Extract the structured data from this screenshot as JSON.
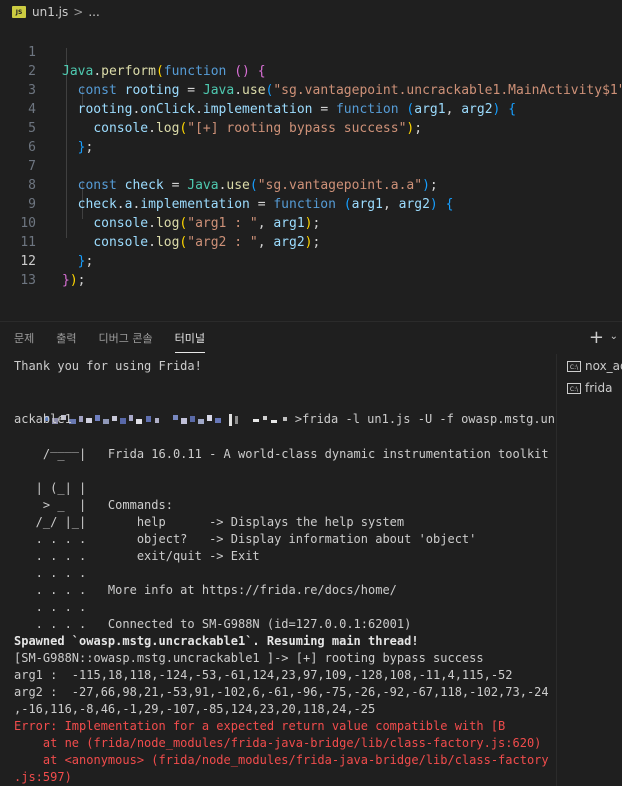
{
  "breadcrumb": {
    "file_icon": "JS",
    "filename": "un1.js",
    "separator": ">",
    "more": "..."
  },
  "editor": {
    "line_numbers": [
      "1",
      "2",
      "3",
      "4",
      "5",
      "6",
      "7",
      "8",
      "9",
      "10",
      "11",
      "12",
      "13"
    ]
  },
  "panel": {
    "tabs": [
      "문제",
      "출력",
      "디버그 콘솔",
      "터미널"
    ],
    "active_tab": 3,
    "new_terminal": "+",
    "dropdown": "⌄"
  },
  "terminal": {
    "thank_you": "Thank you for using Frida!",
    "cmd": ">frida -l un1.js -U -f owasp.mstg.uncr",
    "cmd_cont": "ackable1",
    "logo1": "     ____",
    "logo2": "    / _  |   Frida 16.0.11 - A world-class dynamic instrumentation toolkit",
    "logo3": "   | (_| |",
    "logo4": "    > _  |   Commands:",
    "logo5": "   /_/ |_|       help      -> Displays the help system",
    "logo6": "   . . . .       object?   -> Display information about 'object'",
    "logo7": "   . . . .       exit/quit -> Exit",
    "logo8": "   . . . .",
    "logo9": "   . . . .   More info at https://frida.re/docs/home/",
    "logo10": "   . . . .",
    "logo11": "   . . . .   Connected to SM-G988N (id=127.0.0.1:62001)",
    "spawned": "Spawned `owasp.mstg.uncrackable1`. Resuming main thread!",
    "prompt": "[SM-G988N::owasp.mstg.uncrackable1 ]-> [+] rooting bypass success",
    "arg1": "arg1 :  -115,18,118,-124,-53,-61,124,23,97,109,-128,108,-11,4,115,-52",
    "arg2a": "arg2 :  -27,66,98,21,-53,91,-102,6,-61,-96,-75,-26,-92,-67,118,-102,73,-24",
    "arg2b": ",-16,116,-8,46,-1,29,-107,-85,124,23,20,118,24,-25",
    "err1": "Error: Implementation for a expected return value compatible with [B",
    "err2": "    at ne (frida/node_modules/frida-java-bridge/lib/class-factory.js:620)",
    "err3": "    at <anonymous> (frida/node_modules/frida-java-bridge/lib/class-factory",
    "err4": ".js:597)"
  },
  "terminal_list": [
    {
      "icon": "terminal-icon",
      "name": "nox_ad"
    },
    {
      "icon": "terminal-icon",
      "name": "frida"
    }
  ],
  "colors": {
    "background": "#1f1f1f",
    "keyword": "#569cd6",
    "string": "#ce9178",
    "error": "#f14c4c"
  }
}
